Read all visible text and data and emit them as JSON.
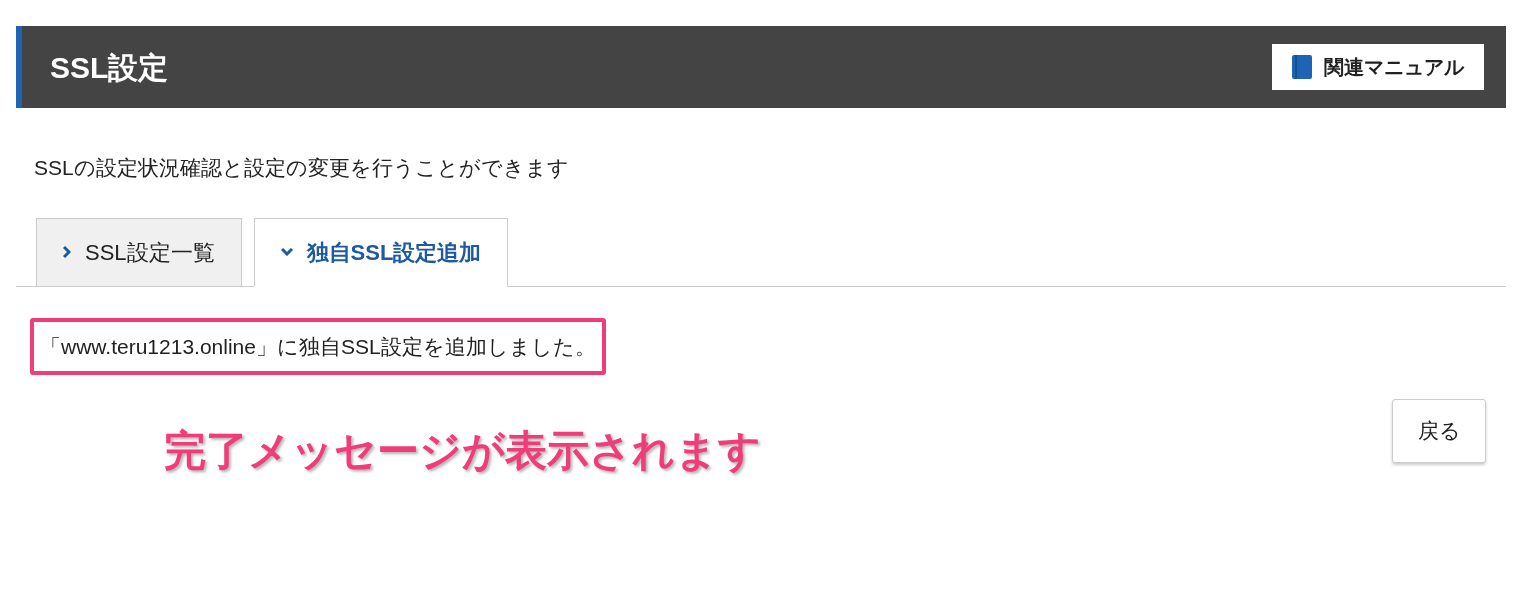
{
  "header": {
    "title": "SSL設定",
    "manual_button": "関連マニュアル"
  },
  "description": "SSLの設定状況確認と設定の変更を行うことができます",
  "tabs": [
    {
      "label": "SSL設定一覧",
      "selected": false
    },
    {
      "label": "独自SSL設定追加",
      "selected": true
    }
  ],
  "message": {
    "text": "「www.teru1213.online」に独自SSL設定を追加しました。",
    "highlighted": true
  },
  "annotation": "完了メッセージが表示されます",
  "back_button": "戻る"
}
